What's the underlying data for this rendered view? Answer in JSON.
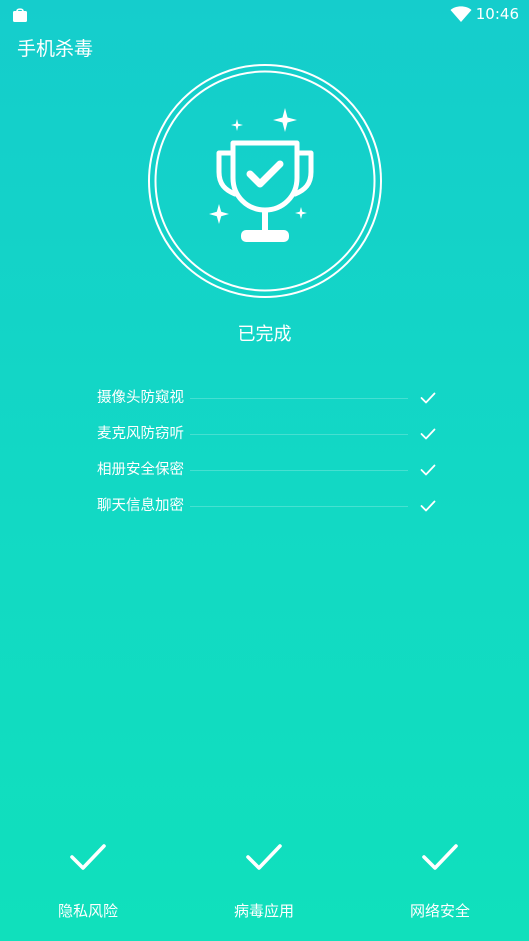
{
  "status_bar": {
    "time": "10:46"
  },
  "header": {
    "title": "手机杀毒"
  },
  "main": {
    "status_label": "已完成"
  },
  "features": [
    {
      "label": "摄像头防窥视"
    },
    {
      "label": "麦克风防窃听"
    },
    {
      "label": "相册安全保密"
    },
    {
      "label": "聊天信息加密"
    }
  ],
  "bottom_tabs": [
    {
      "label": "隐私风险"
    },
    {
      "label": "病毒应用"
    },
    {
      "label": "网络安全"
    }
  ],
  "icons": {
    "status_left": "bag-icon",
    "status_right": "wifi-icon",
    "hero": "trophy-check-icon",
    "list": "check-icon"
  },
  "colors": {
    "gradient_top": "#15cdcc",
    "gradient_bottom": "#10e0bc",
    "foreground": "#ffffff"
  }
}
